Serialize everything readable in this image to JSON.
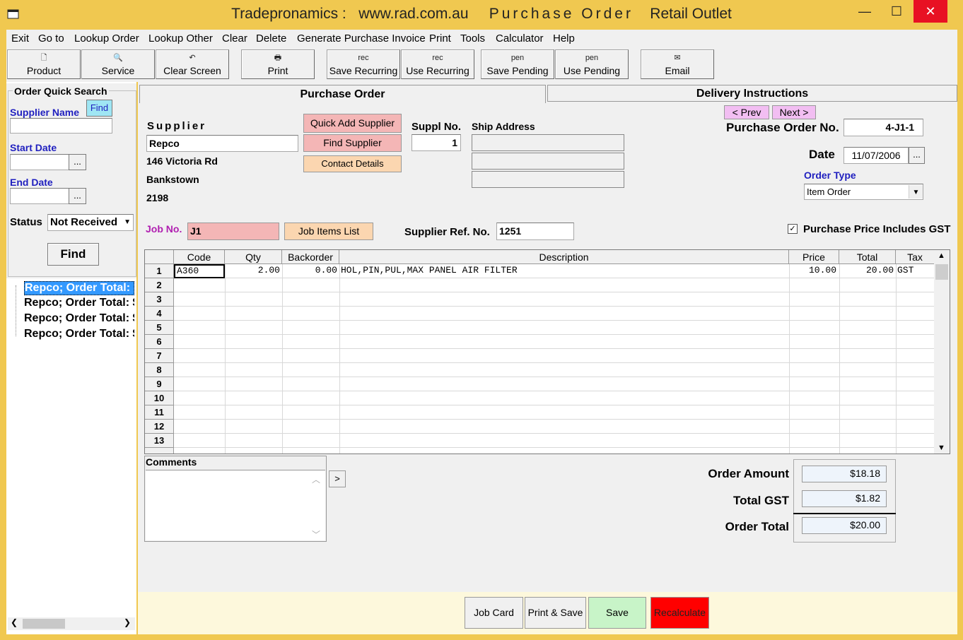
{
  "window": {
    "title_part1": "Tradepronamics :",
    "title_part2": "www.rad.com.au",
    "title_part3": "Purchase Order",
    "title_part4": "Retail Outlet"
  },
  "menu": [
    "Exit",
    "Go to",
    "Lookup Order",
    "Lookup Other",
    "Clear",
    "Delete",
    "Generate Purchase Invoice",
    "Print",
    "Tools",
    "Calculator",
    "Help"
  ],
  "toolbar": [
    {
      "label": "Product",
      "icon": "new-document-icon",
      "glyph": "🗋"
    },
    {
      "label": "Service",
      "icon": "search-document-icon",
      "glyph": "🔍"
    },
    {
      "label": "Clear Screen",
      "icon": "undo-icon",
      "glyph": "↶"
    },
    {
      "label": "Print",
      "icon": "printer-icon",
      "glyph": "🖶"
    },
    {
      "label": "Save Recurring",
      "icon": "rec-icon",
      "glyph": "rec"
    },
    {
      "label": "Use Recurring",
      "icon": "rec-icon",
      "glyph": "rec"
    },
    {
      "label": "Save Pending",
      "icon": "pen-icon",
      "glyph": "pen"
    },
    {
      "label": "Use Pending",
      "icon": "pen-icon",
      "glyph": "pen"
    },
    {
      "label": "Email",
      "icon": "email-icon",
      "glyph": "✉"
    }
  ],
  "quick_search": {
    "title": "Order Quick Search",
    "supplier_label": "Supplier Name",
    "find_small": "Find",
    "start_label": "Start Date",
    "end_label": "End Date",
    "ellipsis": "...",
    "status_label": "Status",
    "status_value": "Not Received",
    "find_button": "Find",
    "results": [
      "Repco; Order Total: $",
      "Repco; Order Total: $",
      "Repco; Order Total: $",
      "Repco; Order Total: $"
    ]
  },
  "tabs": {
    "purchase_order": "Purchase Order",
    "delivery": "Delivery Instructions"
  },
  "supplier": {
    "label": "Supplier",
    "name": "Repco",
    "addr1": "146 Victoria Rd",
    "addr2": "Bankstown",
    "addr3": "2198",
    "quick_add": "Quick Add Supplier",
    "find": "Find Supplier",
    "contact": "Contact Details",
    "suppl_no_label": "Suppl No.",
    "suppl_no": "1",
    "ship_label": "Ship Address"
  },
  "order": {
    "prev": "< Prev",
    "next": "Next >",
    "po_label": "Purchase Order No.",
    "po_no": "4-J1-1",
    "date_label": "Date",
    "date": "11/07/2006",
    "type_label": "Order Type",
    "type_value": "Item Order",
    "job_label": "Job No.",
    "job_no": "J1",
    "job_items": "Job Items List",
    "ref_label": "Supplier Ref. No.",
    "ref_no": "1251",
    "gst_check_label": "Purchase Price Includes GST",
    "gst_checked": true
  },
  "grid": {
    "columns": [
      "Code",
      "Qty",
      "Backorder",
      "Description",
      "Price",
      "Total",
      "Tax"
    ],
    "row_numbers": [
      "1",
      "2",
      "3",
      "4",
      "5",
      "6",
      "7",
      "8",
      "9",
      "10",
      "11",
      "12",
      "13"
    ],
    "rows": [
      {
        "code": "A360",
        "qty": "2.00",
        "backorder": "0.00",
        "description": "HOL,PIN,PUL,MAX PANEL AIR FILTER",
        "price": "10.00",
        "total": "20.00",
        "tax": "GST"
      }
    ]
  },
  "comments_label": "Comments",
  "expand_arrow": ">",
  "totals": {
    "amount_label": "Order Amount",
    "amount": "$18.18",
    "gst_label": "Total GST",
    "gst": "$1.82",
    "total_label": "Order Total",
    "total": "$20.00"
  },
  "bottom_buttons": {
    "job_card": "Job Card",
    "print_save": "Print & Save",
    "save": "Save",
    "recalculate": "Recalculate"
  },
  "colors": {
    "window_bg": "#f0c850",
    "save": "#c8f4c8",
    "recalculate": "#ff0000",
    "selected": "#3399ff"
  }
}
